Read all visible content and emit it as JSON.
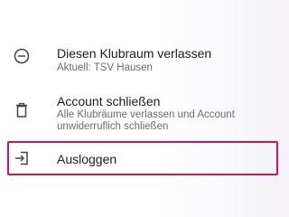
{
  "menu": {
    "leave": {
      "icon": "minus-circle-icon",
      "title": "Diesen Klubraum verlassen",
      "subtitle": "Aktuell: TSV Hausen"
    },
    "close_account": {
      "icon": "trash-icon",
      "title": "Account schließen",
      "subtitle": "Alle Klubräume verlassen und Account unwiderruflich schließen"
    },
    "logout": {
      "icon": "logout-icon",
      "title": "Ausloggen",
      "highlight_color": "#c8175d"
    }
  }
}
